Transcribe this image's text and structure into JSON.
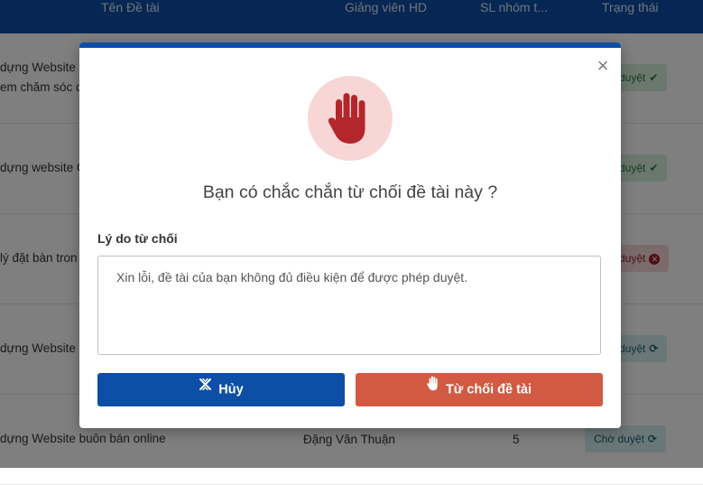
{
  "table": {
    "columns": [
      "Tên Đề tài",
      "Giảng viên HD",
      "SL nhóm t...",
      "Trạng thái"
    ],
    "rows": [
      {
        "title_line1": "dựng Website b",
        "title_line2": "em chăm sóc c",
        "lecturer": "",
        "count": "",
        "status": "duyệt",
        "status_icon": "check-icon"
      },
      {
        "title_line1": "dựng website C",
        "title_line2": "",
        "lecturer": "",
        "count": "",
        "status": "duyệt",
        "status_icon": "check-icon"
      },
      {
        "title_line1": "lý đặt bàn tron",
        "title_line2": "",
        "lecturer": "",
        "count": "",
        "status": "duyệt",
        "status_icon": "x-circle-icon"
      },
      {
        "title_line1": "dựng Website I",
        "title_line2": "",
        "lecturer": "",
        "count": "",
        "status": "duyệt",
        "status_icon": "spinner-icon"
      },
      {
        "title_line1": "dựng Website buôn bán online",
        "title_line2": "",
        "lecturer": "Đặng Văn Thuận",
        "count": "5",
        "status": "Chờ duyệt",
        "status_icon": "spinner-icon"
      }
    ]
  },
  "modal": {
    "close_icon": "close-icon",
    "hand_icon": "stop-hand-icon",
    "question": "Bạn có chắc chắn từ chối đề tài này ?",
    "reason_label": "Lý do từ chối",
    "reason_value": "Xin lỗi, đề tài của bạn không đủ điều kiện để được phép duyệt.",
    "cancel_label": "Hủy",
    "reject_label": "Từ chối đề tài"
  },
  "colors": {
    "primary": "#0d4ea6",
    "danger": "#d25a43",
    "hand": "#b3262b",
    "hand_bg": "#f8d6d6"
  }
}
